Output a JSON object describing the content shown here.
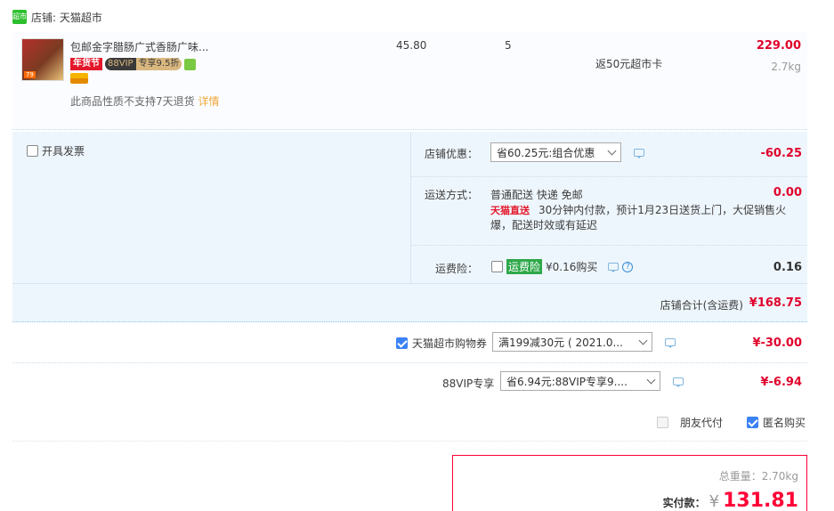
{
  "shop": {
    "icon_text": "超市",
    "label": "店铺: 天猫超市"
  },
  "item": {
    "title": "包邮金字腊肠广式香肠广味...",
    "tag_festival": "年货节",
    "tag_vip": "88VIP",
    "tag_vip_discount": "专享9.5折",
    "thumb_label": "79",
    "note": "此商品性质不支持7天退货",
    "note_link": "详情",
    "price": "45.80",
    "qty": "5",
    "rebate": "返50元超市卡",
    "subtotal": "229.00",
    "weight": "2.7kg"
  },
  "invoice": {
    "label": "开具发票"
  },
  "discount": {
    "label": "店铺优惠：",
    "select": "省60.25元:组合优惠",
    "amount": "-60.25"
  },
  "shipping": {
    "label": "运送方式：",
    "method": "普通配送 快递 免邮",
    "amount": "0.00",
    "badge": "天猫直送",
    "desc": "30分钟内付款，预计1月23日送货上门，大促销售火爆，配送时效或有延迟"
  },
  "insurance": {
    "label": "运费险：",
    "badge": "运费险",
    "text": "¥0.16购买",
    "amount": "0.16"
  },
  "shop_total": {
    "label": "店铺合计(含运费)",
    "amount": "¥168.75"
  },
  "coupon": {
    "label": "天猫超市购物券",
    "select": "满199减30元 ( 2021.0...",
    "amount": "¥-30.00"
  },
  "vip": {
    "label": "88VIP专享",
    "select": "省6.94元:88VIP专享9....",
    "amount": "¥-6.94"
  },
  "options": {
    "friend_pay": "朋友代付",
    "anonymous": "匿名购买"
  },
  "summary": {
    "weight_label": "总重量：",
    "weight": "2.70kg",
    "pay_label": "实付款：",
    "currency": "¥",
    "pay_amount": "131.81"
  }
}
